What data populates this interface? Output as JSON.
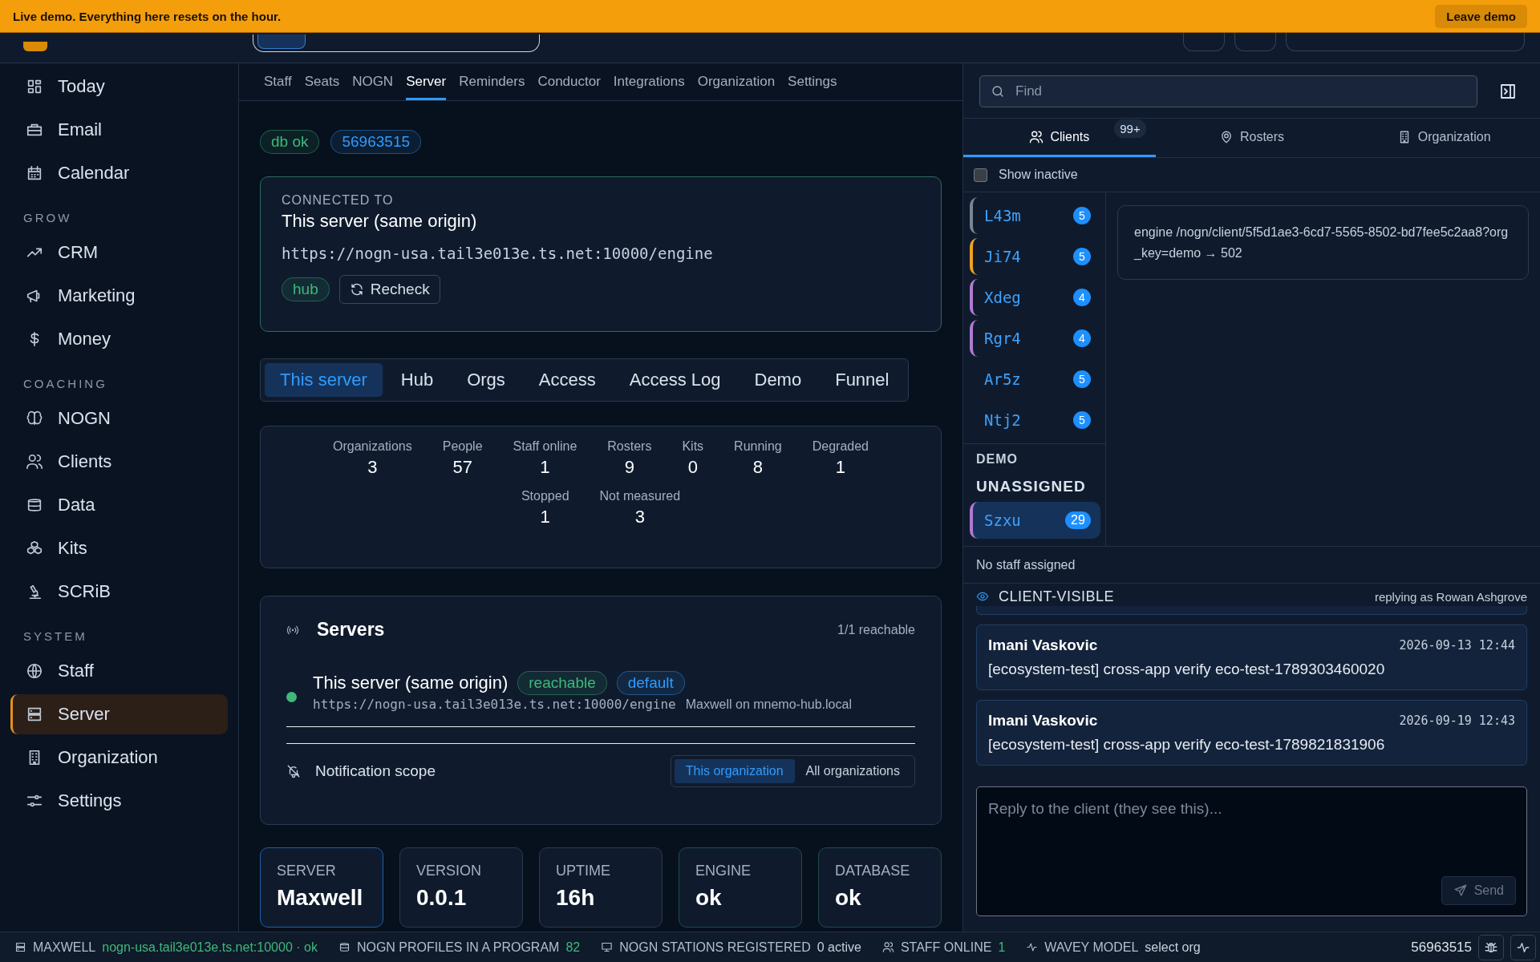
{
  "banner": {
    "text": "Live demo. Everything here resets on the hour.",
    "button": "Leave demo"
  },
  "sidebar": {
    "items": [
      {
        "kind": "item",
        "label": "Today",
        "selected": false
      },
      {
        "kind": "item",
        "label": "Email",
        "selected": false
      },
      {
        "kind": "item",
        "label": "Calendar",
        "selected": false
      },
      {
        "kind": "heading",
        "label": "GROW"
      },
      {
        "kind": "item",
        "label": "CRM",
        "selected": false
      },
      {
        "kind": "item",
        "label": "Marketing",
        "selected": false
      },
      {
        "kind": "item",
        "label": "Money",
        "selected": false
      },
      {
        "kind": "heading",
        "label": "COACHING"
      },
      {
        "kind": "item",
        "label": "NOGN",
        "selected": false
      },
      {
        "kind": "item",
        "label": "Clients",
        "selected": false
      },
      {
        "kind": "item",
        "label": "Data",
        "selected": false
      },
      {
        "kind": "item",
        "label": "Kits",
        "selected": false
      },
      {
        "kind": "item",
        "label": "SCRiB",
        "selected": false
      },
      {
        "kind": "heading",
        "label": "SYSTEM"
      },
      {
        "kind": "item",
        "label": "Staff",
        "selected": false
      },
      {
        "kind": "item",
        "label": "Server",
        "selected": true
      },
      {
        "kind": "item",
        "label": "Organization",
        "selected": false
      },
      {
        "kind": "item",
        "label": "Settings",
        "selected": false
      }
    ]
  },
  "subtabs": [
    {
      "label": "Staff",
      "selected": false
    },
    {
      "label": "Seats",
      "selected": false
    },
    {
      "label": "NOGN",
      "selected": false
    },
    {
      "label": "Server",
      "selected": true
    },
    {
      "label": "Reminders",
      "selected": false
    },
    {
      "label": "Conductor",
      "selected": false
    },
    {
      "label": "Integrations",
      "selected": false
    },
    {
      "label": "Organization",
      "selected": false
    },
    {
      "label": "Settings",
      "selected": false
    }
  ],
  "badges": [
    {
      "label": "db ok",
      "color": "#3fb97a"
    },
    {
      "label": "56963515",
      "color": "#2f9bff"
    }
  ],
  "connected": {
    "caption": "CONNECTED TO",
    "title": "This server (same origin)",
    "url": "https://nogn-usa.tail3e013e.ts.net:10000/engine",
    "tag": "hub",
    "button": "Recheck"
  },
  "segments": [
    {
      "label": "This server",
      "selected": true
    },
    {
      "label": "Hub",
      "selected": false
    },
    {
      "label": "Orgs",
      "selected": false
    },
    {
      "label": "Access",
      "selected": false
    },
    {
      "label": "Access Log",
      "selected": false
    },
    {
      "label": "Demo",
      "selected": false
    },
    {
      "label": "Funnel",
      "selected": false
    }
  ],
  "stat_rows": [
    {
      "items": [
        {
          "label": "Organizations",
          "value": "3"
        },
        {
          "label": "People",
          "value": "57"
        },
        {
          "label": "Staff online",
          "value": "1"
        },
        {
          "label": "Rosters",
          "value": "9"
        },
        {
          "label": "Kits",
          "value": "0"
        },
        {
          "label": "Running",
          "value": "8"
        },
        {
          "label": "Degraded",
          "value": "1"
        }
      ]
    },
    {
      "items": [
        {
          "label": "Stopped",
          "value": "1"
        },
        {
          "label": "Not measured",
          "value": "3"
        }
      ]
    }
  ],
  "servers": {
    "title": "Servers",
    "summary": "1/1 reachable",
    "items": [
      {
        "name": "This server (same origin)",
        "online": true,
        "tags": [
          {
            "label": "reachable",
            "color": "#3fb97a"
          },
          {
            "label": "default",
            "color": "#2f9bff"
          }
        ],
        "url": "https://nogn-usa.tail3e013e.ts.net:10000/engine",
        "host": "Maxwell on mnemo-hub.local"
      }
    ],
    "scope": {
      "label": "Notification scope",
      "options": [
        {
          "label": "This organization",
          "selected": true
        },
        {
          "label": "All organizations",
          "selected": false
        }
      ]
    }
  },
  "metrics": [
    {
      "label": "SERVER",
      "value": "Maxwell",
      "color": "#1f5fa8"
    },
    {
      "label": "VERSION",
      "value": "0.0.1",
      "color": "#2c3a4d"
    },
    {
      "label": "UPTIME",
      "value": "16h",
      "color": "#2c3a4d"
    },
    {
      "label": "ENGINE",
      "value": "ok",
      "color": "#1f4d45"
    },
    {
      "label": "DATABASE",
      "value": "ok",
      "color": "#1f4d45"
    }
  ],
  "right": {
    "find": {
      "placeholder": "Find"
    },
    "tabs": [
      {
        "label": "Clients",
        "selected": true,
        "badge": "99+"
      },
      {
        "label": "Rosters",
        "selected": false
      },
      {
        "label": "Organization",
        "selected": false
      }
    ],
    "show_inactive": {
      "label": "Show inactive",
      "checked": false
    },
    "groups": [
      {
        "clients": [
          {
            "name": "L43m",
            "count": "5",
            "color": "#7a8594",
            "selected": false
          },
          {
            "name": "Ji74",
            "count": "5",
            "color": "#f0a020",
            "selected": false
          },
          {
            "name": "Xdeg",
            "count": "4",
            "color": "#b07ad0",
            "selected": false
          },
          {
            "name": "Rgr4",
            "count": "4",
            "color": "#b07ad0",
            "selected": false
          },
          {
            "name": "Ar5z",
            "count": "5",
            "selected": false
          },
          {
            "name": "Ntj2",
            "count": "5",
            "selected": false
          }
        ]
      },
      {
        "heading": "DEMO",
        "subheading": "UNASSIGNED",
        "clients": [
          {
            "name": "Szxu",
            "count": "29",
            "color": "#b07ad0",
            "selected": true
          }
        ]
      }
    ],
    "detail": "engine /nogn/client/5f5d1ae3-6cd7-5565-8502-bd7fee5c2aa8?org_key=demo → 502",
    "staff_note": "No staff assigned",
    "thread": {
      "visibility": "CLIENT-VISIBLE",
      "replying_as": "replying as Rowan Ashgrove",
      "messages": [
        {
          "author": "Imani Vaskovic",
          "time": "2026-09-13 12:44",
          "text": "[ecosystem-test] cross-app verify eco-test-1789303460020"
        },
        {
          "author": "Imani Vaskovic",
          "time": "2026-09-19 12:43",
          "text": "[ecosystem-test] cross-app verify eco-test-1789821831906"
        }
      ],
      "reply": {
        "placeholder": "Reply to the client (they see this)...",
        "button": "Send"
      }
    }
  },
  "status_bar": {
    "items": [
      {
        "label": "MAXWELL",
        "value": "nogn-usa.tail3e013e.ts.net:10000 · ok",
        "color": "#3fb97a"
      },
      {
        "label": "NOGN PROFILES IN A PROGRAM",
        "value": "82",
        "color": "#3fb97a"
      },
      {
        "label": "NOGN STATIONS REGISTERED",
        "value": "0 active",
        "color": "#c7d0dc"
      },
      {
        "label": "STAFF ONLINE",
        "value": "1",
        "color": "#3fb97a"
      },
      {
        "label": "WAVEY MODEL",
        "value": "select org",
        "color": "#c7d0dc"
      }
    ],
    "build": "56963515"
  }
}
